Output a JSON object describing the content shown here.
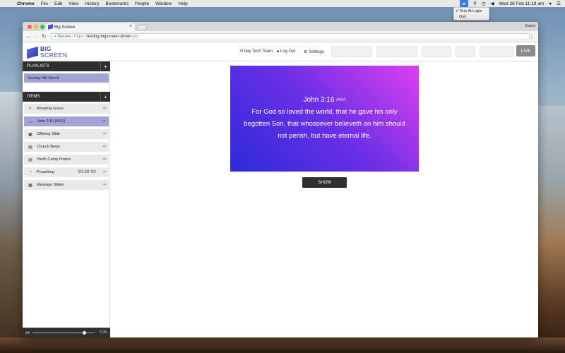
{
  "menubar": {
    "items": [
      "Chrome",
      "File",
      "Edit",
      "View",
      "History",
      "Bookmarks",
      "People",
      "Window",
      "Help"
    ],
    "datetime": "Wed 28 Feb  11:18 am"
  },
  "tray_menu": {
    "run_at_login": "✔ Run At Login",
    "quit": "Quit"
  },
  "browser": {
    "tab_title": "Big Screen",
    "guest": "Guest",
    "url_secure": "Secure",
    "url_scheme": "https://",
    "url_host": "testing.bigscreen.show",
    "url_path": "/spo"
  },
  "header": {
    "logo_line1": "BIG",
    "logo_line2": "SCREEN",
    "team": "G'day Tech Team",
    "logout": "Log Out",
    "settings": "Settings",
    "live": "LIVE"
  },
  "sidebar": {
    "playlists_title": "PLAYLISTS",
    "playlist_item": "Sunday 4th March",
    "items_title": "ITEMS",
    "plus": "+",
    "items": [
      {
        "icon": "♬",
        "label": "Amazing Grace",
        "time": ""
      },
      {
        "icon": "▭",
        "label": "John 3:16 (ASV)",
        "time": ""
      },
      {
        "icon": "▣",
        "label": "Offering Slide",
        "time": ""
      },
      {
        "icon": "▤",
        "label": "Church News",
        "time": ""
      },
      {
        "icon": "▤",
        "label": "Youth Camp Promo",
        "time": ""
      },
      {
        "icon": "◔",
        "label": "Preaching",
        "time": "00:30:00"
      },
      {
        "icon": "▦",
        "label": "Message Slides",
        "time": ""
      }
    ],
    "speed": "0.3s"
  },
  "slide": {
    "reference": "John 3:16",
    "version": "(ASV)",
    "verse": "For God so loved the world, that he gave his only begotten Son, that whosoever believeth on him should not perish, but have eternal life.",
    "show_label": "SHOW"
  }
}
